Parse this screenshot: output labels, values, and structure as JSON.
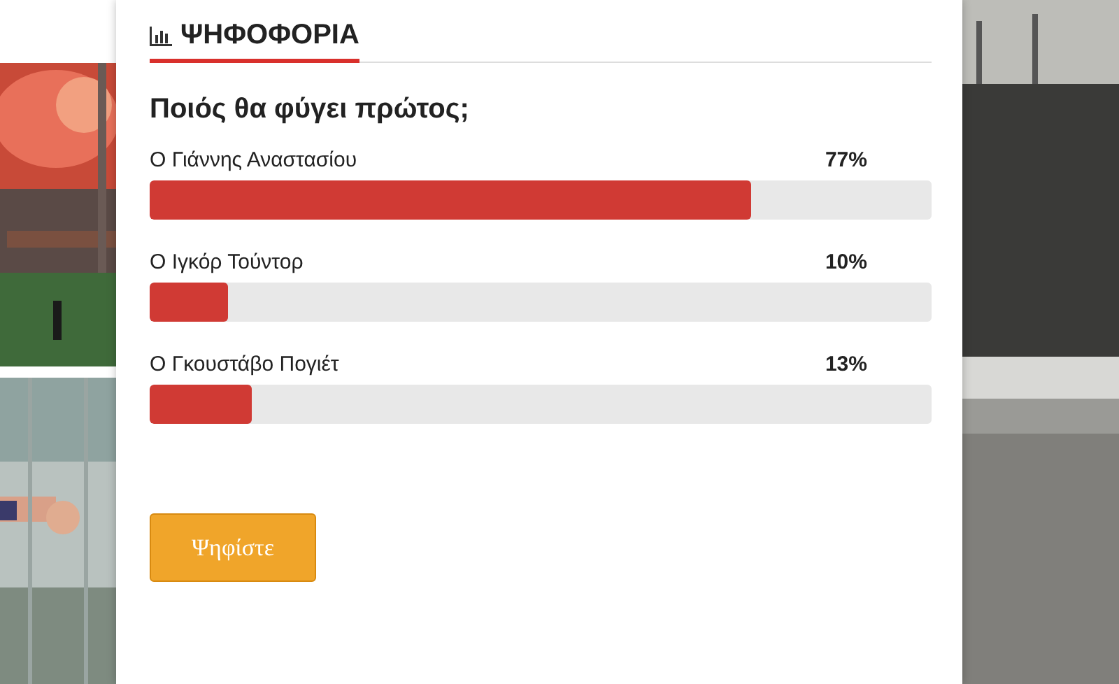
{
  "poll": {
    "title": "ΨΗΦΟΦΟΡΙΑ",
    "question": "Ποιός θα φύγει πρώτος;",
    "options": [
      {
        "label": "Ο Γιάννης Αναστασίου",
        "percent": "77%",
        "level": 0.77
      },
      {
        "label": "Ο Ιγκόρ Τούντορ",
        "percent": "10%",
        "level": 0.1
      },
      {
        "label": "Ο Γκουστάβο Πογιέτ",
        "percent": "13%",
        "level": 0.13
      }
    ],
    "button": "Ψηφίστε"
  }
}
